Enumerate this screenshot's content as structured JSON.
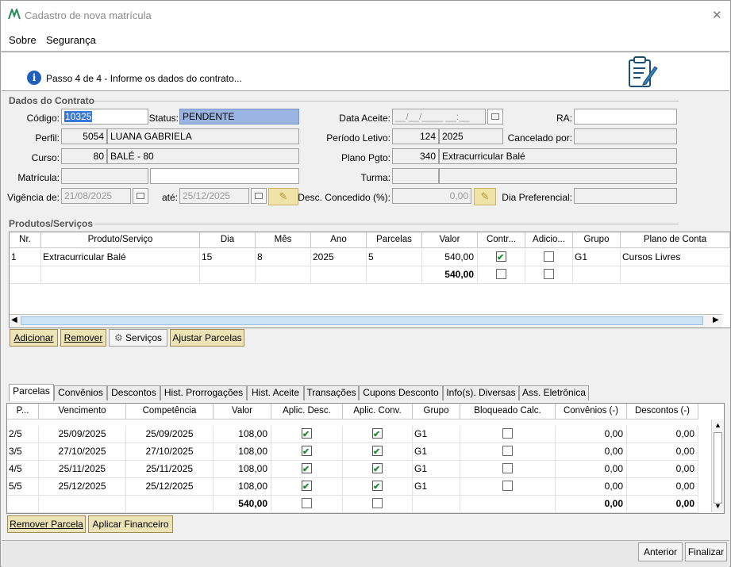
{
  "window": {
    "title": "Cadastro de nova matrícula",
    "close_glyph": "✕"
  },
  "menu": {
    "items": [
      "Sobre",
      "Segurança"
    ]
  },
  "header": {
    "step": "Passo 4 de 4 - Informe os dados do contrato..."
  },
  "contract": {
    "legend": "Dados do Contrato",
    "codigo_label": "Código:",
    "codigo": "10325",
    "status_label": "Status:",
    "status": "PENDENTE",
    "data_aceite_label": "Data Aceite:",
    "data_aceite": "__/__/____ __:__",
    "ra_label": "RA:",
    "ra": "",
    "perfil_label": "Perfil:",
    "perfil_id": "5054",
    "perfil_nome": "LUANA GABRIELA",
    "periodo_label": "Período Letivo:",
    "periodo_id": "124",
    "periodo": "2025",
    "cancelado_label": "Cancelado por:",
    "cancelado": "",
    "curso_label": "Curso:",
    "curso_id": "80",
    "curso_nome": "BALÉ - 80",
    "plano_label": "Plano Pgto:",
    "plano_id": "340",
    "plano_nome": "Extracurricular Balé",
    "matricula_label": "Matrícula:",
    "matricula_a": "",
    "matricula_b": "",
    "turma_label": "Turma:",
    "turma_a": "",
    "turma_b": "",
    "vigencia_label": "Vigência de:",
    "vigencia_de": "21/08/2025",
    "ate_label": "até:",
    "vigencia_ate": "25/12/2025",
    "desc_label": "Desc. Concedido (%):",
    "desc": "0,00",
    "dia_pref_label": "Dia Preferencial:",
    "dia_pref": ""
  },
  "produtos": {
    "legend": "Produtos/Serviços",
    "columns": [
      "Nr.",
      "Produto/Serviço",
      "Dia",
      "Mês",
      "Ano",
      "Parcelas",
      "Valor",
      "Contr...",
      "Adicio...",
      "Grupo",
      "Plano de Conta"
    ],
    "rows": [
      {
        "nr": "1",
        "produto": "Extracurricular Balé",
        "dia": "15",
        "mes": "8",
        "ano": "2025",
        "parcelas": "5",
        "valor": "540,00",
        "contr": true,
        "adicional": false,
        "grupo": "G1",
        "plano": "Cursos Livres"
      }
    ],
    "total": {
      "valor": "540,00",
      "contr": false,
      "adicional": false
    },
    "buttons": {
      "adicionar": "Adicionar",
      "remover": "Remover",
      "servicos": "Serviços",
      "ajustar": "Ajustar Parcelas"
    }
  },
  "tabs": [
    "Parcelas",
    "Convênios",
    "Descontos",
    "Hist. Prorrogações",
    "Hist. Aceite",
    "Transações",
    "Cupons Desconto",
    "Info(s). Diversas",
    "Ass. Eletrônica"
  ],
  "parcelas": {
    "columns": [
      "P...",
      "Vencimento",
      "Competência",
      "Valor",
      "Aplic. Desc.",
      "Aplic. Conv.",
      "Grupo",
      "Bloqueado Calc.",
      "Convênios (-)",
      "Descontos (-)"
    ],
    "rows": [
      {
        "p": "2/5",
        "venc": "25/09/2025",
        "comp": "25/09/2025",
        "valor": "108,00",
        "desc": true,
        "conv": true,
        "grupo": "G1",
        "bloq": false,
        "convenios": "0,00",
        "descontos": "0,00"
      },
      {
        "p": "3/5",
        "venc": "27/10/2025",
        "comp": "27/10/2025",
        "valor": "108,00",
        "desc": true,
        "conv": true,
        "grupo": "G1",
        "bloq": false,
        "convenios": "0,00",
        "descontos": "0,00"
      },
      {
        "p": "4/5",
        "venc": "25/11/2025",
        "comp": "25/11/2025",
        "valor": "108,00",
        "desc": true,
        "conv": true,
        "grupo": "G1",
        "bloq": false,
        "convenios": "0,00",
        "descontos": "0,00"
      },
      {
        "p": "5/5",
        "venc": "25/12/2025",
        "comp": "25/12/2025",
        "valor": "108,00",
        "desc": true,
        "conv": true,
        "grupo": "G1",
        "bloq": false,
        "convenios": "0,00",
        "descontos": "0,00"
      }
    ],
    "total": {
      "valor": "540,00",
      "convenios": "0,00",
      "descontos": "0,00"
    },
    "buttons": {
      "remover": "Remover Parcela",
      "aplicar": "Aplicar Financeiro"
    }
  },
  "footer": {
    "anterior": "Anterior",
    "finalizar": "Finalizar"
  },
  "colors": {
    "status_bg": "#99b4e0",
    "button_bg": "#ece3b6",
    "check": "#1d8a2e",
    "info_icon": "#1f5fbf"
  }
}
